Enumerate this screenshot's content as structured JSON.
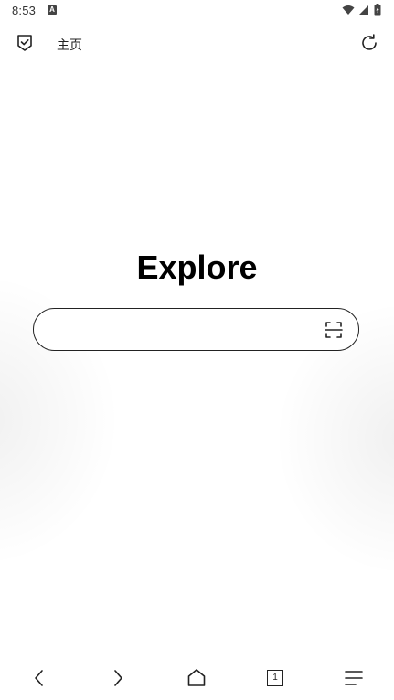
{
  "status_bar": {
    "time": "8:53",
    "app_icon_letter": "A",
    "icons": [
      "wifi-icon",
      "signal-icon",
      "battery-icon"
    ]
  },
  "top_bar": {
    "shield_icon": "shield-check-icon",
    "title": "主页",
    "refresh_icon": "refresh-icon"
  },
  "main": {
    "title": "Explore",
    "search": {
      "value": "",
      "placeholder": ""
    },
    "scan_icon": "scan-icon"
  },
  "bottom_nav": {
    "items": [
      {
        "icon": "back-icon"
      },
      {
        "icon": "forward-icon"
      },
      {
        "icon": "home-icon"
      },
      {
        "icon": "tabs-icon",
        "count": "1"
      },
      {
        "icon": "menu-icon"
      }
    ]
  },
  "colors": {
    "foreground": "#222222",
    "background": "#ffffff"
  }
}
